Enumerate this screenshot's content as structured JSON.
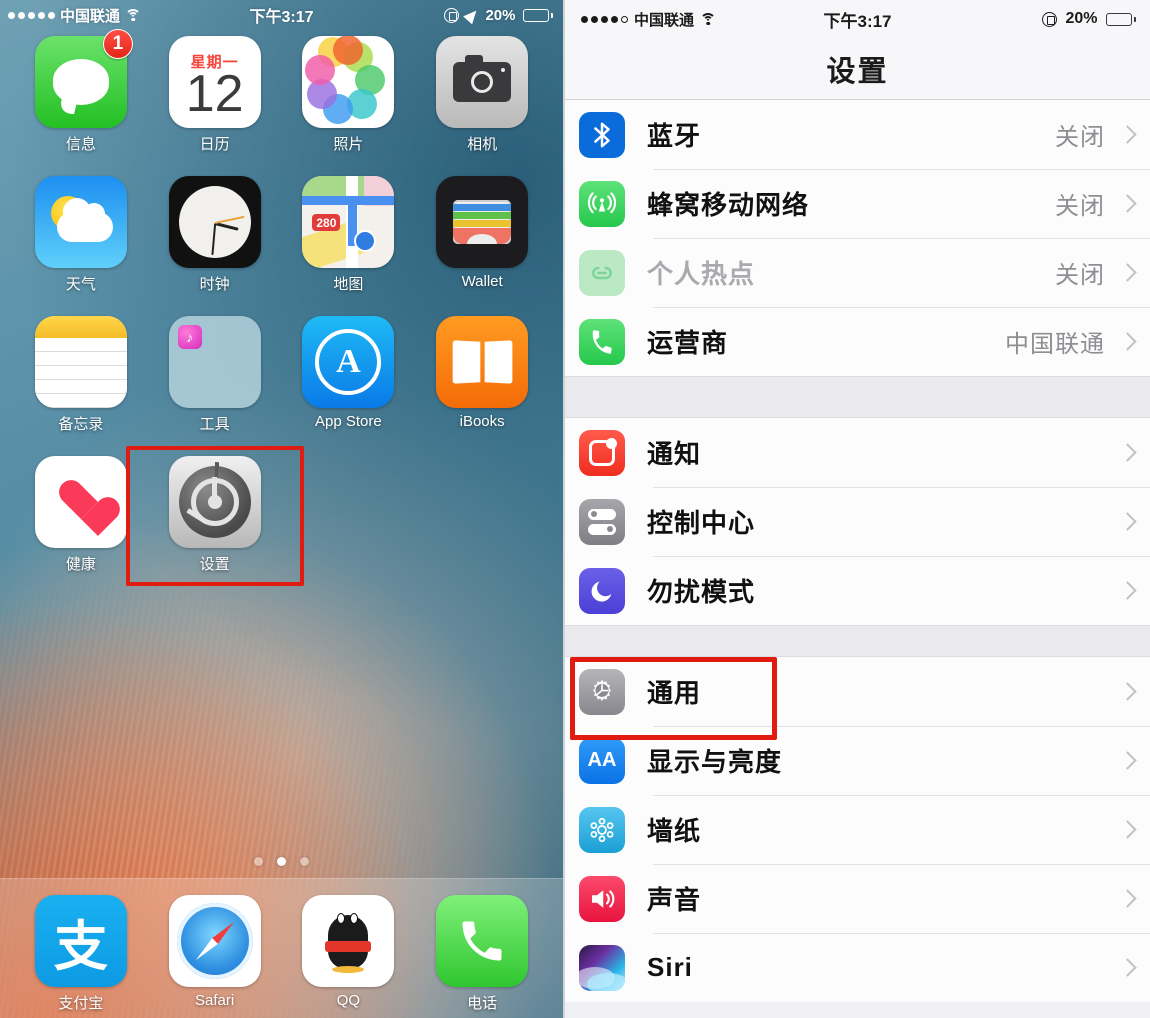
{
  "home": {
    "status_bar": {
      "signal_dots": 5,
      "carrier": "中国联通",
      "wifi_icon": "wifi-icon",
      "time": "下午3:17",
      "rotation_lock_icon": "rotation-lock-icon",
      "location_icon": "location-arrow-icon",
      "battery_percent": "20%",
      "battery_level": 20
    },
    "apps": [
      {
        "name": "信息",
        "icon": "messages-icon",
        "badge": "1"
      },
      {
        "name": "日历",
        "icon": "calendar-icon",
        "weekday": "星期一",
        "day": "12"
      },
      {
        "name": "照片",
        "icon": "photos-icon"
      },
      {
        "name": "相机",
        "icon": "camera-icon"
      },
      {
        "name": "天气",
        "icon": "weather-icon"
      },
      {
        "name": "时钟",
        "icon": "clock-icon"
      },
      {
        "name": "地图",
        "icon": "maps-icon",
        "shield_text": "280"
      },
      {
        "name": "Wallet",
        "icon": "wallet-icon"
      },
      {
        "name": "备忘录",
        "icon": "notes-icon"
      },
      {
        "name": "工具",
        "icon": "folder-icon"
      },
      {
        "name": "App Store",
        "icon": "appstore-icon"
      },
      {
        "name": "iBooks",
        "icon": "ibooks-icon"
      },
      {
        "name": "健康",
        "icon": "health-icon"
      },
      {
        "name": "设置",
        "icon": "settings-gear-icon",
        "highlighted": true
      }
    ],
    "page_dots": {
      "count": 3,
      "active_index": 1
    },
    "dock": [
      {
        "name": "支付宝",
        "icon": "alipay-icon",
        "glyph": "支"
      },
      {
        "name": "Safari",
        "icon": "safari-compass-icon"
      },
      {
        "name": "QQ",
        "icon": "qq-penguin-icon"
      },
      {
        "name": "电话",
        "icon": "phone-icon"
      }
    ],
    "highlight_color": "#e11b0f"
  },
  "settings": {
    "status_bar": {
      "signal_dots_filled": 4,
      "signal_dots_total": 5,
      "carrier": "中国联通",
      "wifi_icon": "wifi-icon",
      "time": "下午3:17",
      "rotation_lock_icon": "rotation-lock-icon",
      "battery_percent": "20%",
      "battery_level": 20
    },
    "nav_title": "设置",
    "groups": [
      {
        "rows": [
          {
            "label": "蓝牙",
            "value": "关闭",
            "icon": "bluetooth-icon",
            "dim": false
          },
          {
            "label": "蜂窝移动网络",
            "value": "关闭",
            "icon": "cellular-icon",
            "dim": false
          },
          {
            "label": "个人热点",
            "value": "关闭",
            "icon": "hotspot-icon",
            "dim": true
          },
          {
            "label": "运营商",
            "value": "中国联通",
            "icon": "carrier-phone-icon",
            "dim": false
          }
        ]
      },
      {
        "rows": [
          {
            "label": "通知",
            "value": "",
            "icon": "notifications-icon",
            "dim": false
          },
          {
            "label": "控制中心",
            "value": "",
            "icon": "control-center-icon",
            "dim": false
          },
          {
            "label": "勿扰模式",
            "value": "",
            "icon": "do-not-disturb-icon",
            "dim": false
          }
        ]
      },
      {
        "rows": [
          {
            "label": "通用",
            "value": "",
            "icon": "general-gear-icon",
            "dim": false,
            "highlighted": true
          },
          {
            "label": "显示与亮度",
            "value": "",
            "icon": "display-brightness-icon",
            "dim": false,
            "glyph": "AA"
          },
          {
            "label": "墙纸",
            "value": "",
            "icon": "wallpaper-icon",
            "dim": false
          },
          {
            "label": "声音",
            "value": "",
            "icon": "sound-icon",
            "dim": false
          },
          {
            "label": "Siri",
            "value": "",
            "icon": "siri-icon",
            "dim": false
          }
        ]
      }
    ],
    "highlight_color": "#e11b0f"
  }
}
